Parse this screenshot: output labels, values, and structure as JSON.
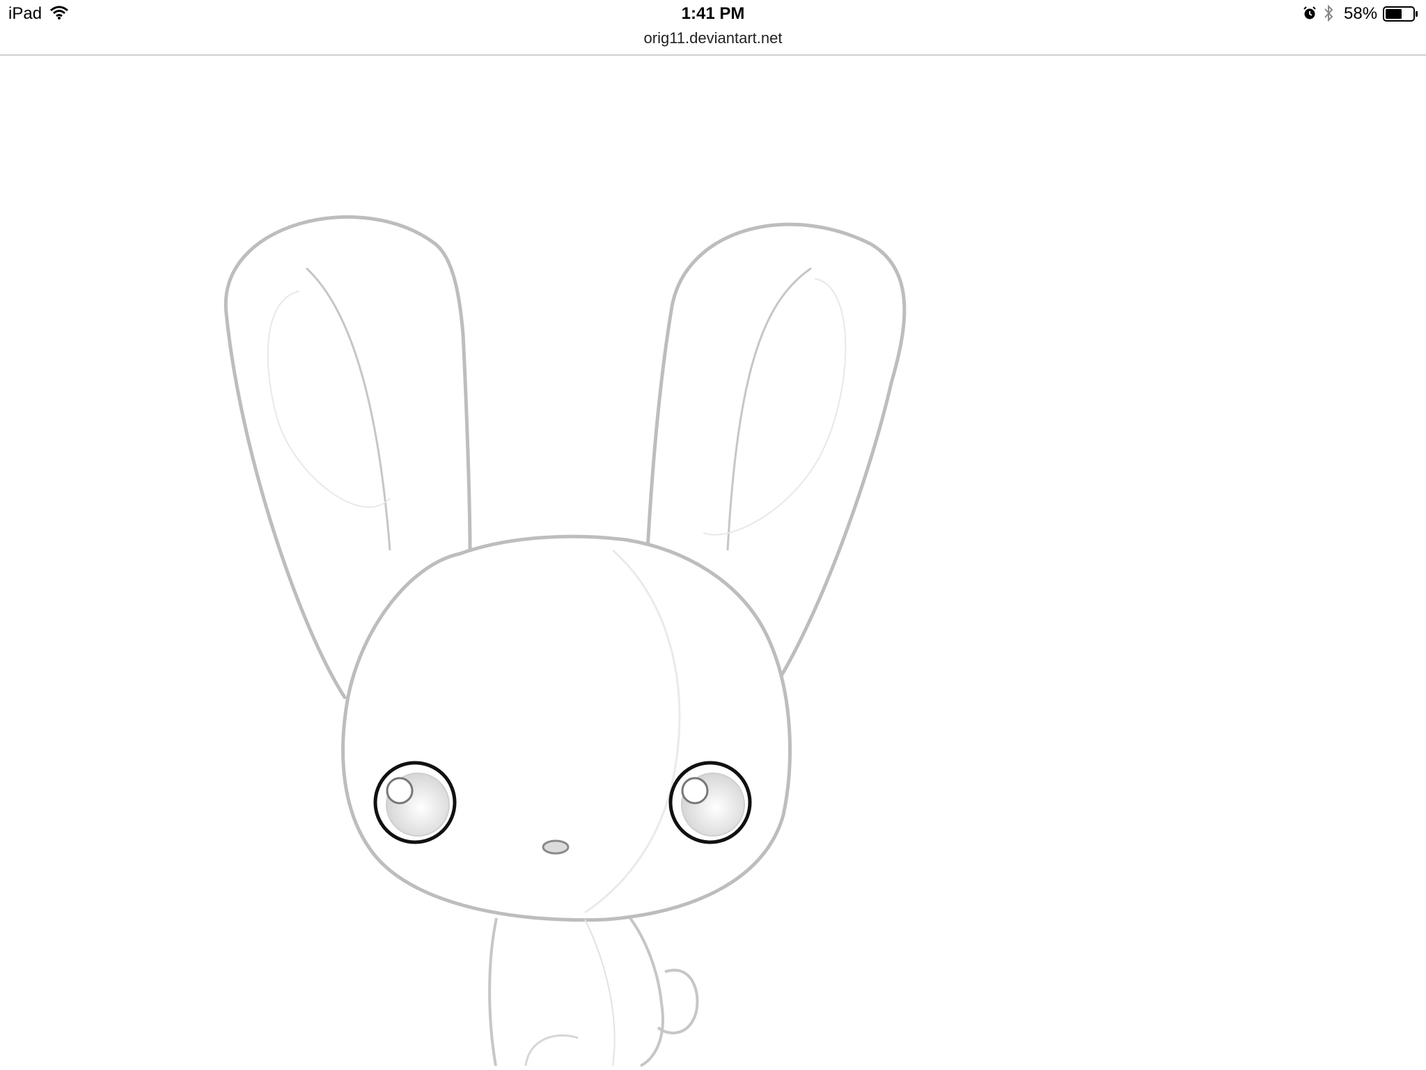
{
  "status_bar": {
    "device": "iPad",
    "time": "1:41 PM",
    "battery": "58%",
    "icons": [
      "wifi-icon",
      "alarm-icon",
      "bluetooth-icon",
      "battery-icon"
    ]
  },
  "browser": {
    "url": "orig11.deviantart.net"
  },
  "content": {
    "image": "bunny-line-drawing"
  },
  "colors": {
    "line": "#bdbdbd",
    "eye_outline": "#111111",
    "divider": "#d0d0d0"
  }
}
